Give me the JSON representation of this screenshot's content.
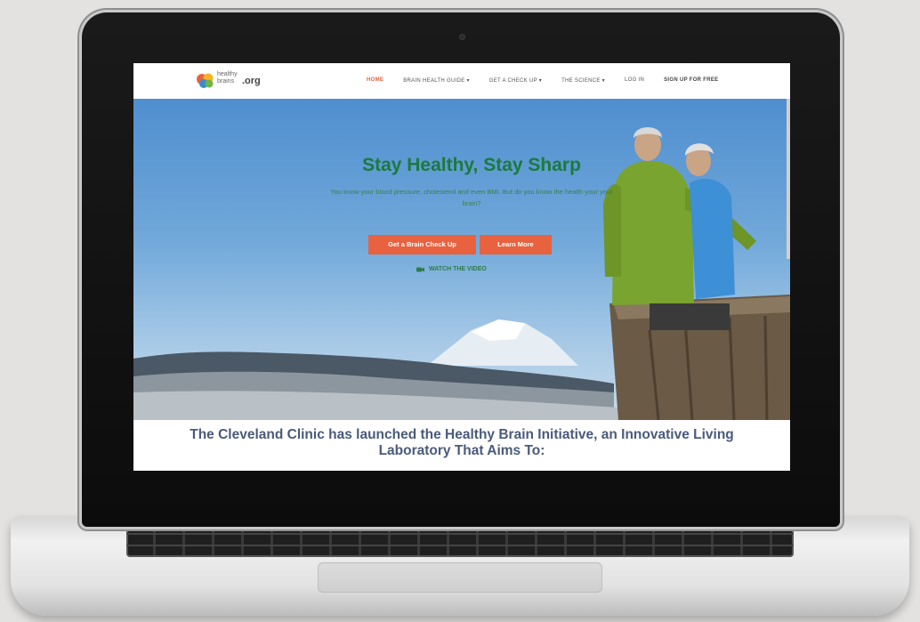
{
  "site": {
    "logo": {
      "line1": "healthy",
      "line2": "brains",
      "domain": ".org"
    },
    "nav": [
      {
        "label": "HOME",
        "active": true
      },
      {
        "label": "BRAIN HEALTH GUIDE ▾",
        "active": false
      },
      {
        "label": "GET A CHECK UP ▾",
        "active": false
      },
      {
        "label": "THE SCIENCE ▾",
        "active": false
      },
      {
        "label": "LOG IN",
        "active": false
      },
      {
        "label": "SIGN UP FOR FREE",
        "active": false
      }
    ],
    "hero": {
      "title": "Stay Healthy, Stay Sharp",
      "subtitle": "You know your blood pressure, cholesterol and even BMI. But do you know the health your your brain?",
      "primary_button": "Get a Brain Check Up",
      "secondary_button": "Learn More",
      "video_link": "WATCH THE VIDEO"
    },
    "headline": "The Cleveland Clinic has launched the Healthy Brain Initiative, an Innovative Living Laboratory That Aims To:"
  },
  "colors": {
    "accent": "#e8623f",
    "title_green": "#1c7a3d",
    "headline_blue": "#4a5a7a"
  },
  "icons": [
    "brain-logo-icon",
    "camera-icon",
    "chevron-down-icon"
  ]
}
